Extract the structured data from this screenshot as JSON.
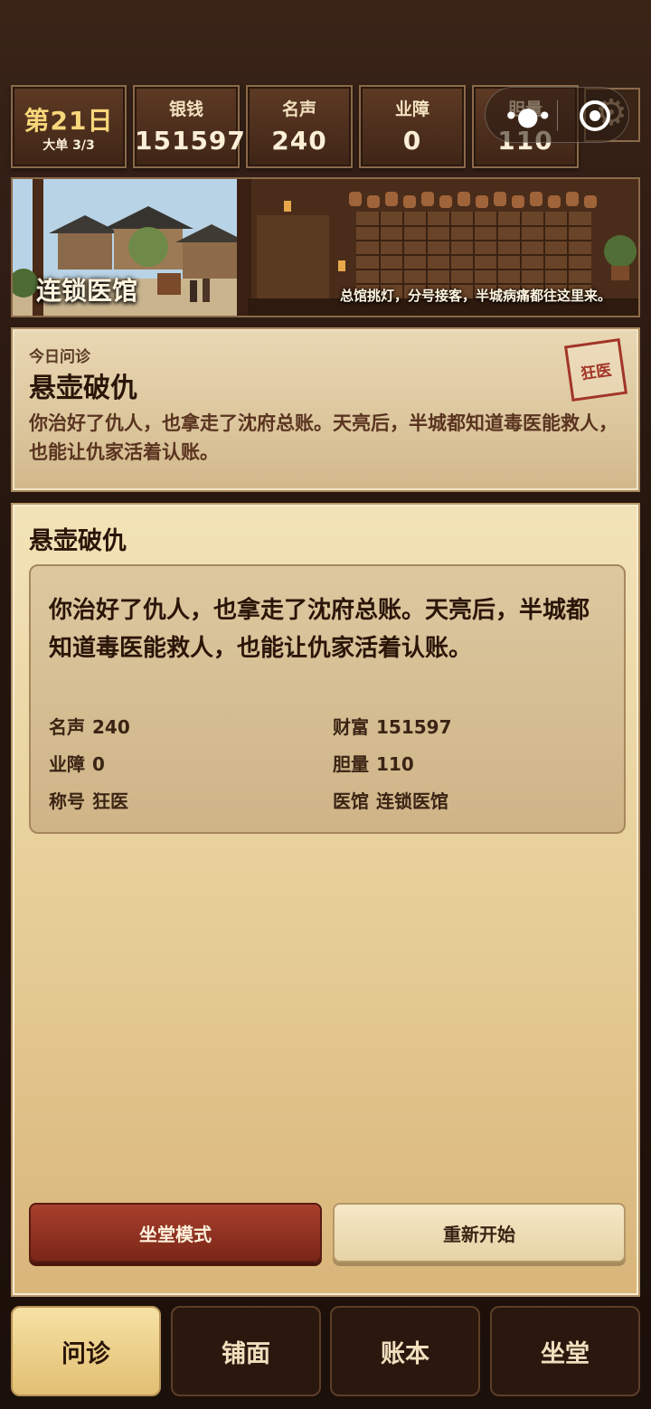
{
  "stats": {
    "day": {
      "label": "第21日",
      "sub": "大单 3/3"
    },
    "silver": {
      "label": "银钱",
      "value": "151597"
    },
    "fame": {
      "label": "名声",
      "value": "240"
    },
    "karma": {
      "label": "业障",
      "value": "0"
    },
    "courage": {
      "label": "胆量",
      "value": "110"
    }
  },
  "capsule": {
    "more_icon": "more-dots-icon",
    "close_icon": "target-ring-icon"
  },
  "settings": {
    "icon": "gear-icon"
  },
  "banner": {
    "title": "连锁医馆",
    "subtitle": "总馆挑灯，分号接客，半城病痛都往这里来。"
  },
  "today": {
    "kicker": "今日问诊",
    "title": "悬壶破仇",
    "description": "你治好了仇人，也拿走了沈府总账。天亮后，半城都知道毒医能救人，也能让仇家活着认账。",
    "stamp": "狂医"
  },
  "panel": {
    "title": "悬壶破仇",
    "text": "你治好了仇人，也拿走了沈府总账。天亮后，半城都知道毒医能救人，也能让仇家活着认账。",
    "stats": [
      {
        "k": "名声",
        "v": "240"
      },
      {
        "k": "财富",
        "v": "151597"
      },
      {
        "k": "业障",
        "v": "0"
      },
      {
        "k": "胆量",
        "v": "110"
      },
      {
        "k": "称号",
        "v": "狂医"
      },
      {
        "k": "医馆",
        "v": "连锁医馆"
      }
    ],
    "buttons": {
      "primary": "坐堂模式",
      "secondary": "重新开始"
    }
  },
  "tabs": [
    {
      "label": "问诊",
      "active": true
    },
    {
      "label": "铺面",
      "active": false
    },
    {
      "label": "账本",
      "active": false
    },
    {
      "label": "坐堂",
      "active": false
    }
  ],
  "colors": {
    "accent_red": "#a23528",
    "gold": "#f7d77a",
    "panel_bg": "#f2e3b8",
    "dark_bg": "#24150e"
  }
}
